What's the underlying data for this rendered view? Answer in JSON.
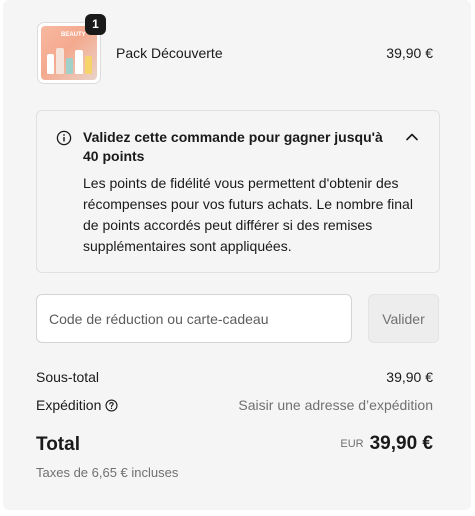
{
  "line_item": {
    "quantity": "1",
    "name": "Pack Découverte",
    "price": "39,90 €",
    "image_text": "BEAUTY"
  },
  "loyalty": {
    "icon": "info-icon",
    "title": "Validez cette commande pour gagner jusqu'à 40 points",
    "body": "Les points de fidélité vous permettent d'obtenir des récompenses pour vos futurs achats. Le nombre final de points accordés peut différer si des remises supplémentaires sont appliquées.",
    "toggle_icon": "chevron-up-icon"
  },
  "discount": {
    "placeholder": "Code de réduction ou carte-cadeau",
    "value": "",
    "button_label": "Valider"
  },
  "summary": {
    "subtotal_label": "Sous-total",
    "subtotal_value": "39,90 €",
    "shipping_label": "Expédition",
    "shipping_icon": "question-circle-icon",
    "shipping_value": "Saisir une adresse d’expédition",
    "total_label": "Total",
    "currency": "EUR",
    "total_value": "39,90 €",
    "taxes": "Taxes de 6,65 € incluses"
  },
  "colors": {
    "panel_bg": "#f5f5f5",
    "text": "#1a1a1a",
    "muted": "#707070",
    "badge_bg": "#1a1a1a"
  }
}
